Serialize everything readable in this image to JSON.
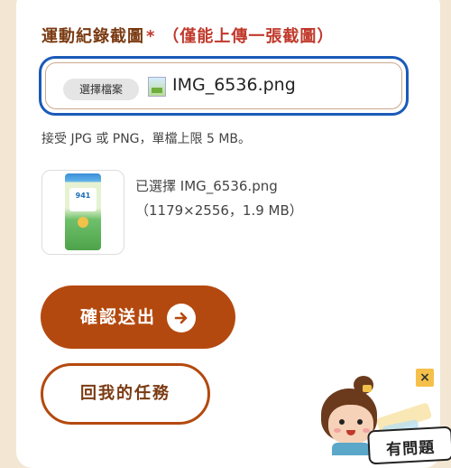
{
  "form": {
    "field_label": "運動紀錄截圖",
    "required_mark": "*",
    "field_note": "（僅能上傳一張截圖）",
    "choose_file_label": "選擇檔案",
    "file_name": "IMG_6536.png",
    "hint": "接受 JPG 或 PNG，單檔上限 5 MB。"
  },
  "preview": {
    "selected_line": "已選擇 IMG_6536.png",
    "meta_line": "（1179×2556，1.9 MB）",
    "thumb_text": "941"
  },
  "actions": {
    "submit_label": "確認送出",
    "back_label": "回我的任務"
  },
  "helper": {
    "close_glyph": "×",
    "bubble_text": "有問題"
  },
  "colors": {
    "accent": "#b4490f",
    "label": "#7a3a12",
    "required": "#c0392b",
    "focus_ring": "#1a5ab8",
    "page_bg": "#f3e6d3"
  },
  "icons": [
    "file-image-icon",
    "arrow-right-icon",
    "close-icon"
  ]
}
